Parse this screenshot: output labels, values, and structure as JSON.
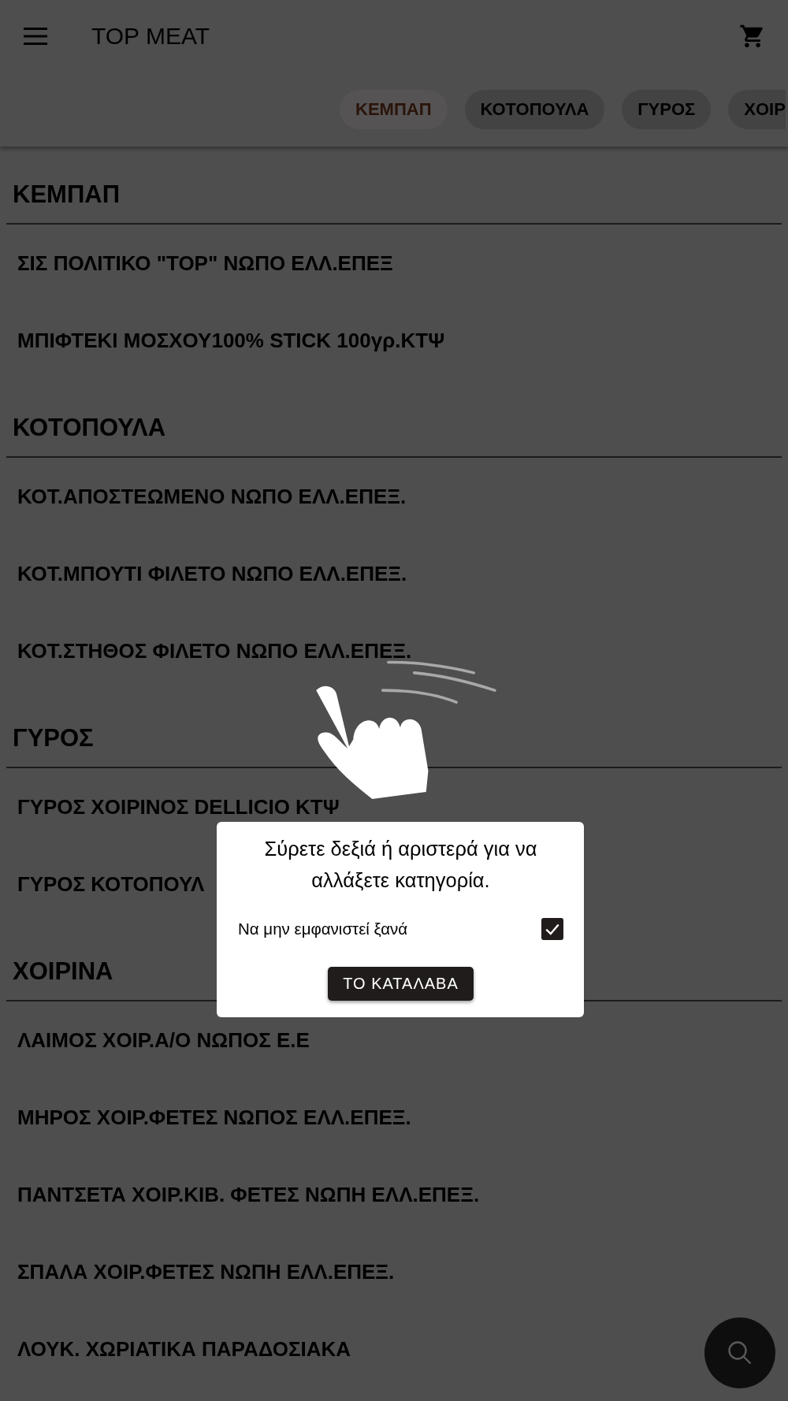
{
  "app_bar": {
    "title": "TOP MEAT"
  },
  "category_tabs": [
    {
      "label": "ΚΕΜΠΑΠ",
      "selected": true
    },
    {
      "label": "ΚΟΤΟΠΟΥΛΑ",
      "selected": false
    },
    {
      "label": "ΓΥΡΟΣ",
      "selected": false
    },
    {
      "label": "ΧΟΙΡ",
      "selected": false
    }
  ],
  "sections": [
    {
      "title": "ΚΕΜΠΑΠ",
      "items": [
        "ΣΙΣ ΠΟΛΙΤΙΚΟ \"TOP\" ΝΩΠΟ ΕΛΛ.ΕΠΕΞ",
        "ΜΠΙΦΤΕΚΙ ΜΟΣΧΟΥ100% STICK 100γρ.ΚΤΨ"
      ]
    },
    {
      "title": "ΚΟΤΟΠΟΥΛΑ",
      "items": [
        "ΚΟΤ.ΑΠΟΣΤΕΩΜΕΝΟ ΝΩΠΟ ΕΛΛ.ΕΠΕΞ.",
        "ΚΟΤ.ΜΠΟΥΤΙ ΦΙΛΕΤΟ ΝΩΠΟ ΕΛΛ.ΕΠΕΞ.",
        "ΚΟΤ.ΣΤΗΘΟΣ ΦΙΛΕΤΟ ΝΩΠΟ ΕΛΛ.ΕΠΕΞ."
      ]
    },
    {
      "title": "ΓΥΡΟΣ",
      "items": [
        "ΓΥΡΟΣ ΧΟΙΡΙΝΟΣ DELLICIO ΚΤΨ",
        "ΓΥΡΟΣ ΚΟΤΟΠΟΥΛ"
      ]
    },
    {
      "title": "ΧΟΙΡΙΝΑ",
      "items": [
        "ΛΑΙΜΟΣ ΧΟΙΡ.Α/Ο ΝΩΠΟΣ Ε.Ε",
        "ΜΗΡΟΣ ΧΟΙΡ.ΦΕΤΕΣ ΝΩΠΟΣ ΕΛΛ.ΕΠΕΞ.",
        "ΠΑΝΤΣΕΤΑ ΧΟΙΡ.ΚΙΒ. ΦΕΤΕΣ ΝΩΠΗ ΕΛΛ.ΕΠΕΞ.",
        "ΣΠΑΛΑ ΧΟΙΡ.ΦΕΤΕΣ ΝΩΠΗ ΕΛΛ.ΕΠΕΞ.",
        "ΛΟΥΚ. ΧΩΡΙΑΤΙΚΑ ΠΑΡΑΔΟΣΙΑΚΑ"
      ]
    }
  ],
  "dialog": {
    "message": "Σύρετε δεξιά ή αριστερά για να αλλάξετε κατηγορία.",
    "checkbox_label": "Να μην εμφανιστεί ξανά",
    "checked": true,
    "button": "ΤΟ ΚΑΤΑΛΑΒΑ"
  }
}
